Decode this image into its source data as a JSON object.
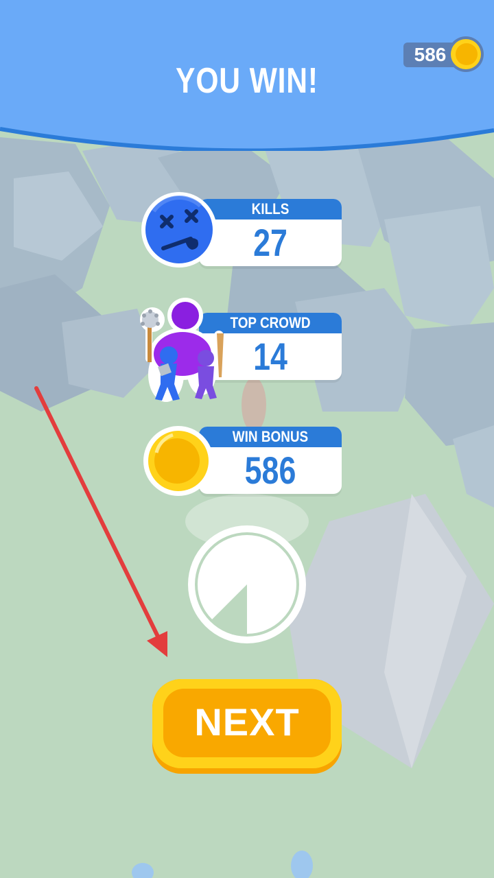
{
  "header": {
    "title": "YOU WIN!"
  },
  "currency": {
    "amount": "586",
    "icon": "coin-icon"
  },
  "stats": {
    "kills": {
      "label": "KILLS",
      "value": "27",
      "icon": "dead-face-icon"
    },
    "top_crowd": {
      "label": "TOP CROWD",
      "value": "14",
      "icon": "crowd-icon"
    },
    "win_bonus": {
      "label": "WIN BONUS",
      "value": "586",
      "icon": "coin-icon"
    }
  },
  "timer": {
    "icon": "countdown-timer-icon",
    "progress": 0.875
  },
  "next_button": {
    "label": "NEXT"
  },
  "colors": {
    "header_blue": "#6aaaf8",
    "stat_blue": "#2b7bd8",
    "button_orange": "#f9a800",
    "button_yellow": "#ffd21a",
    "arrow_red": "#e33d3d",
    "crowd_purple": "#8a1fe0",
    "crowd_blue": "#2f6df0"
  }
}
